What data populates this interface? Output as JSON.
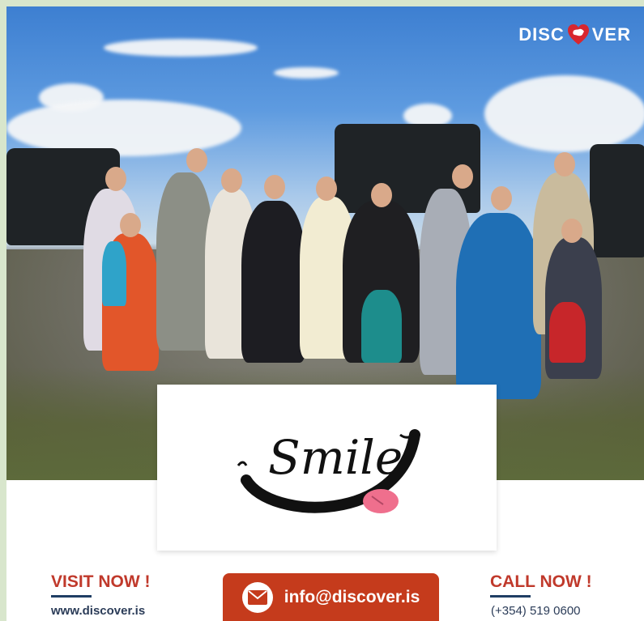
{
  "brand": {
    "text_left": "DISC",
    "text_right": "VER",
    "icon": "iceland-heart-icon"
  },
  "card": {
    "logo_text": "Smile",
    "icon": "smile-logo-icon"
  },
  "visit": {
    "title": "VISIT NOW !",
    "url": "www.discover.is"
  },
  "email": {
    "address": "info@discover.is",
    "icon": "mail-icon"
  },
  "call": {
    "title": "CALL NOW !",
    "phone": "(+354) 519 0600"
  },
  "colors": {
    "accent": "#c53b1c",
    "heading": "#c0392b",
    "navy": "#1f3e64",
    "bg": "#d8e6cc"
  }
}
